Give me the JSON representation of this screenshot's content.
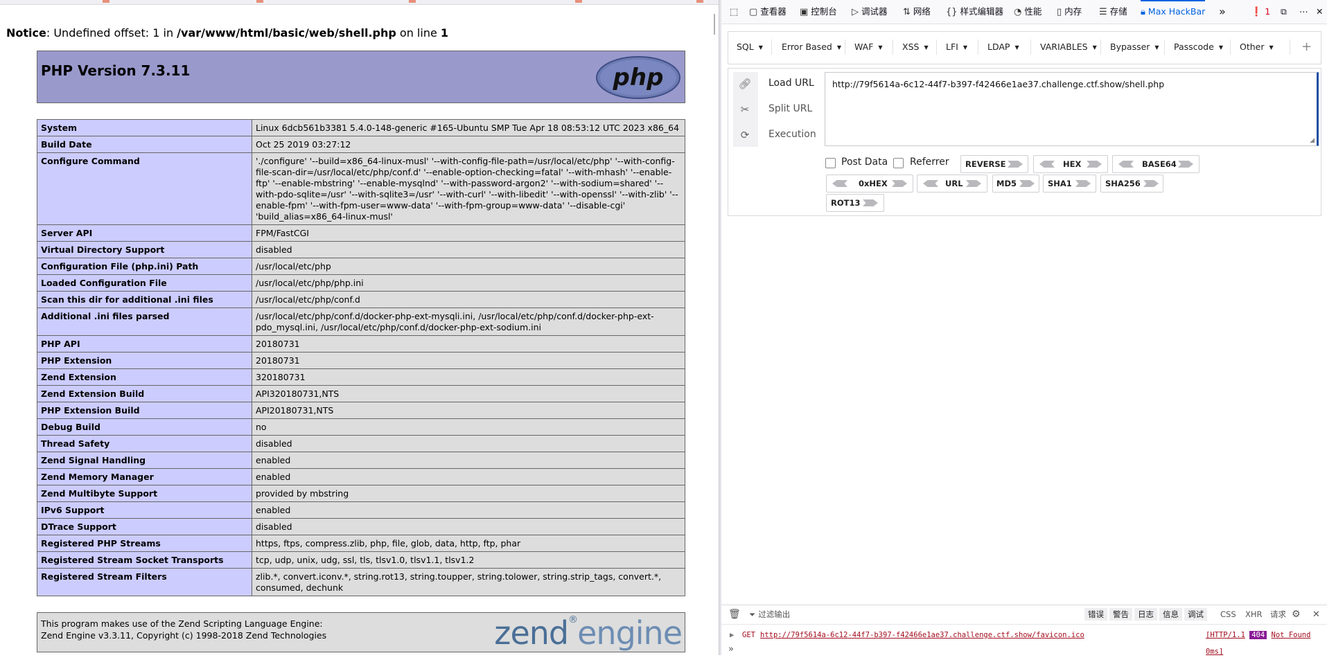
{
  "page": {
    "notice_label": "Notice",
    "notice_mid": ": Undefined offset: 1 in ",
    "notice_path": "/var/www/html/basic/web/shell.php",
    "notice_on": " on line ",
    "notice_line": "1",
    "php_version": "PHP Version 7.3.11",
    "php_logo_text": "php",
    "rows": [
      {
        "k": "System",
        "v": "Linux 6dcb561b3381 5.4.0-148-generic #165-Ubuntu SMP Tue Apr 18 08:53:12 UTC 2023 x86_64"
      },
      {
        "k": "Build Date",
        "v": "Oct 25 2019 03:27:12"
      },
      {
        "k": "Configure Command",
        "v": "'./configure' '--build=x86_64-linux-musl' '--with-config-file-path=/usr/local/etc/php' '--with-config-file-scan-dir=/usr/local/etc/php/conf.d' '--enable-option-checking=fatal' '--with-mhash' '--enable-ftp' '--enable-mbstring' '--enable-mysqlnd' '--with-password-argon2' '--with-sodium=shared' '--with-pdo-sqlite=/usr' '--with-sqlite3=/usr' '--with-curl' '--with-libedit' '--with-openssl' '--with-zlib' '--enable-fpm' '--with-fpm-user=www-data' '--with-fpm-group=www-data' '--disable-cgi' 'build_alias=x86_64-linux-musl'"
      },
      {
        "k": "Server API",
        "v": "FPM/FastCGI"
      },
      {
        "k": "Virtual Directory Support",
        "v": "disabled"
      },
      {
        "k": "Configuration File (php.ini) Path",
        "v": "/usr/local/etc/php"
      },
      {
        "k": "Loaded Configuration File",
        "v": "/usr/local/etc/php/php.ini"
      },
      {
        "k": "Scan this dir for additional .ini files",
        "v": "/usr/local/etc/php/conf.d"
      },
      {
        "k": "Additional .ini files parsed",
        "v": "/usr/local/etc/php/conf.d/docker-php-ext-mysqli.ini, /usr/local/etc/php/conf.d/docker-php-ext-pdo_mysql.ini, /usr/local/etc/php/conf.d/docker-php-ext-sodium.ini"
      },
      {
        "k": "PHP API",
        "v": "20180731"
      },
      {
        "k": "PHP Extension",
        "v": "20180731"
      },
      {
        "k": "Zend Extension",
        "v": "320180731"
      },
      {
        "k": "Zend Extension Build",
        "v": "API320180731,NTS"
      },
      {
        "k": "PHP Extension Build",
        "v": "API20180731,NTS"
      },
      {
        "k": "Debug Build",
        "v": "no"
      },
      {
        "k": "Thread Safety",
        "v": "disabled"
      },
      {
        "k": "Zend Signal Handling",
        "v": "enabled"
      },
      {
        "k": "Zend Memory Manager",
        "v": "enabled"
      },
      {
        "k": "Zend Multibyte Support",
        "v": "provided by mbstring"
      },
      {
        "k": "IPv6 Support",
        "v": "enabled"
      },
      {
        "k": "DTrace Support",
        "v": "disabled"
      },
      {
        "k": "Registered PHP Streams",
        "v": "https, ftps, compress.zlib, php, file, glob, data, http, ftp, phar"
      },
      {
        "k": "Registered Stream Socket Transports",
        "v": "tcp, udp, unix, udg, ssl, tls, tlsv1.0, tlsv1.1, tlsv1.2"
      },
      {
        "k": "Registered Stream Filters",
        "v": "zlib.*, convert.iconv.*, string.rot13, string.toupper, string.tolower, string.strip_tags, convert.*, consumed, dechunk"
      }
    ],
    "zend_line1": "This program makes use of the Zend Scripting Language Engine:",
    "zend_line2": "Zend Engine v3.3.11, Copyright (c) 1998-2018 Zend Technologies",
    "zend_logo_a": "zend",
    "zend_logo_b": "engine"
  },
  "devtools": {
    "tabs": [
      "查看器",
      "控制台",
      "调试器",
      "网络",
      "样式编辑器",
      "性能",
      "内存",
      "存储",
      "Max HackBar"
    ],
    "error_count": "1",
    "accent": "#0061e0"
  },
  "hackbar": {
    "menus": [
      "SQL",
      "Error Based",
      "WAF",
      "XSS",
      "LFI",
      "LDAP",
      "VARIABLES",
      "Bypasser",
      "Passcode",
      "Other"
    ],
    "plus": "+",
    "actions": [
      "Load URL",
      "Split URL",
      "Execution"
    ],
    "url": "http://79f5614a-6c12-44f7-b397-f42466e1ae37.challenge.ctf.show/shell.php",
    "post_data": "Post Data",
    "referrer": "Referrer",
    "buttons": [
      "REVERSE",
      "HEX",
      "BASE64",
      "0xHEX",
      "URL",
      "MD5",
      "SHA1",
      "SHA256",
      "ROT13"
    ]
  },
  "console": {
    "filter_placeholder": "过滤输出",
    "filters": [
      "错误",
      "警告",
      "日志",
      "信息",
      "调试"
    ],
    "right_filters": [
      "CSS",
      "XHR",
      "请求"
    ],
    "method": "GET",
    "request_url": "http://79f5614a-6c12-44f7-b397-f42466e1ae37.challenge.ctf.show/favicon.ico",
    "status_pre": "[HTTP/1.1",
    "status_code": "404",
    "status_post": "Not Found 0ms]",
    "prompt": "»"
  }
}
